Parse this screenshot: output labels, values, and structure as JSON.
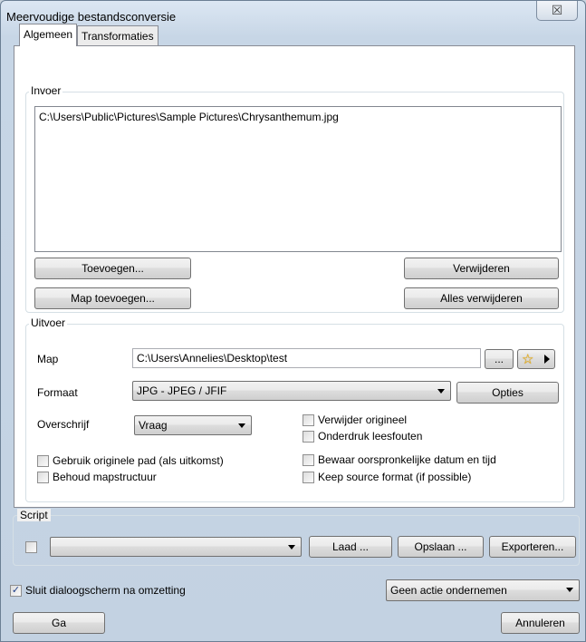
{
  "window": {
    "title": "Meervoudige bestandsconversie",
    "close_glyph": "☒"
  },
  "tabs": [
    {
      "label": "Algemeen",
      "active": true
    },
    {
      "label": "Transformaties",
      "active": false
    }
  ],
  "input": {
    "group_label": "Invoer",
    "files": [
      "C:\\Users\\Public\\Pictures\\Sample Pictures\\Chrysanthemum.jpg"
    ],
    "add_button": "Toevoegen...",
    "add_folder_button": "Map toevoegen...",
    "remove_button": "Verwijderen",
    "remove_all_button": "Alles verwijderen"
  },
  "output": {
    "group_label": "Uitvoer",
    "folder_label": "Map",
    "folder_value": "C:\\Users\\Annelies\\Desktop\\test",
    "browse_button": "...",
    "format_label": "Formaat",
    "format_value": "JPG - JPEG / JFIF",
    "options_button": "Opties",
    "overwrite_label": "Overschrijf",
    "overwrite_value": "Vraag",
    "checkboxes": {
      "use_original_path": {
        "label": "Gebruik originele pad (als uitkomst)",
        "checked": false
      },
      "keep_folder_structure": {
        "label": "Behoud mapstructuur",
        "checked": false
      },
      "delete_original": {
        "label": "Verwijder origineel",
        "checked": false
      },
      "suppress_read_errors": {
        "label": "Onderdruk leesfouten",
        "checked": false
      },
      "keep_original_date": {
        "label": "Bewaar oorspronkelijke datum en tijd",
        "checked": false
      },
      "keep_source_format": {
        "label": "Keep source format (if possible)",
        "checked": false
      }
    }
  },
  "script": {
    "group_label": "Script",
    "enabled": false,
    "selected": "",
    "load_button": "Laad ...",
    "save_button": "Opslaan ...",
    "export_button": "Exporteren..."
  },
  "footer": {
    "close_after_label": "Sluit dialoogscherm na omzetting",
    "close_after_checked": true,
    "action_value": "Geen actie ondernemen",
    "go_button": "Ga",
    "cancel_button": "Annuleren"
  }
}
